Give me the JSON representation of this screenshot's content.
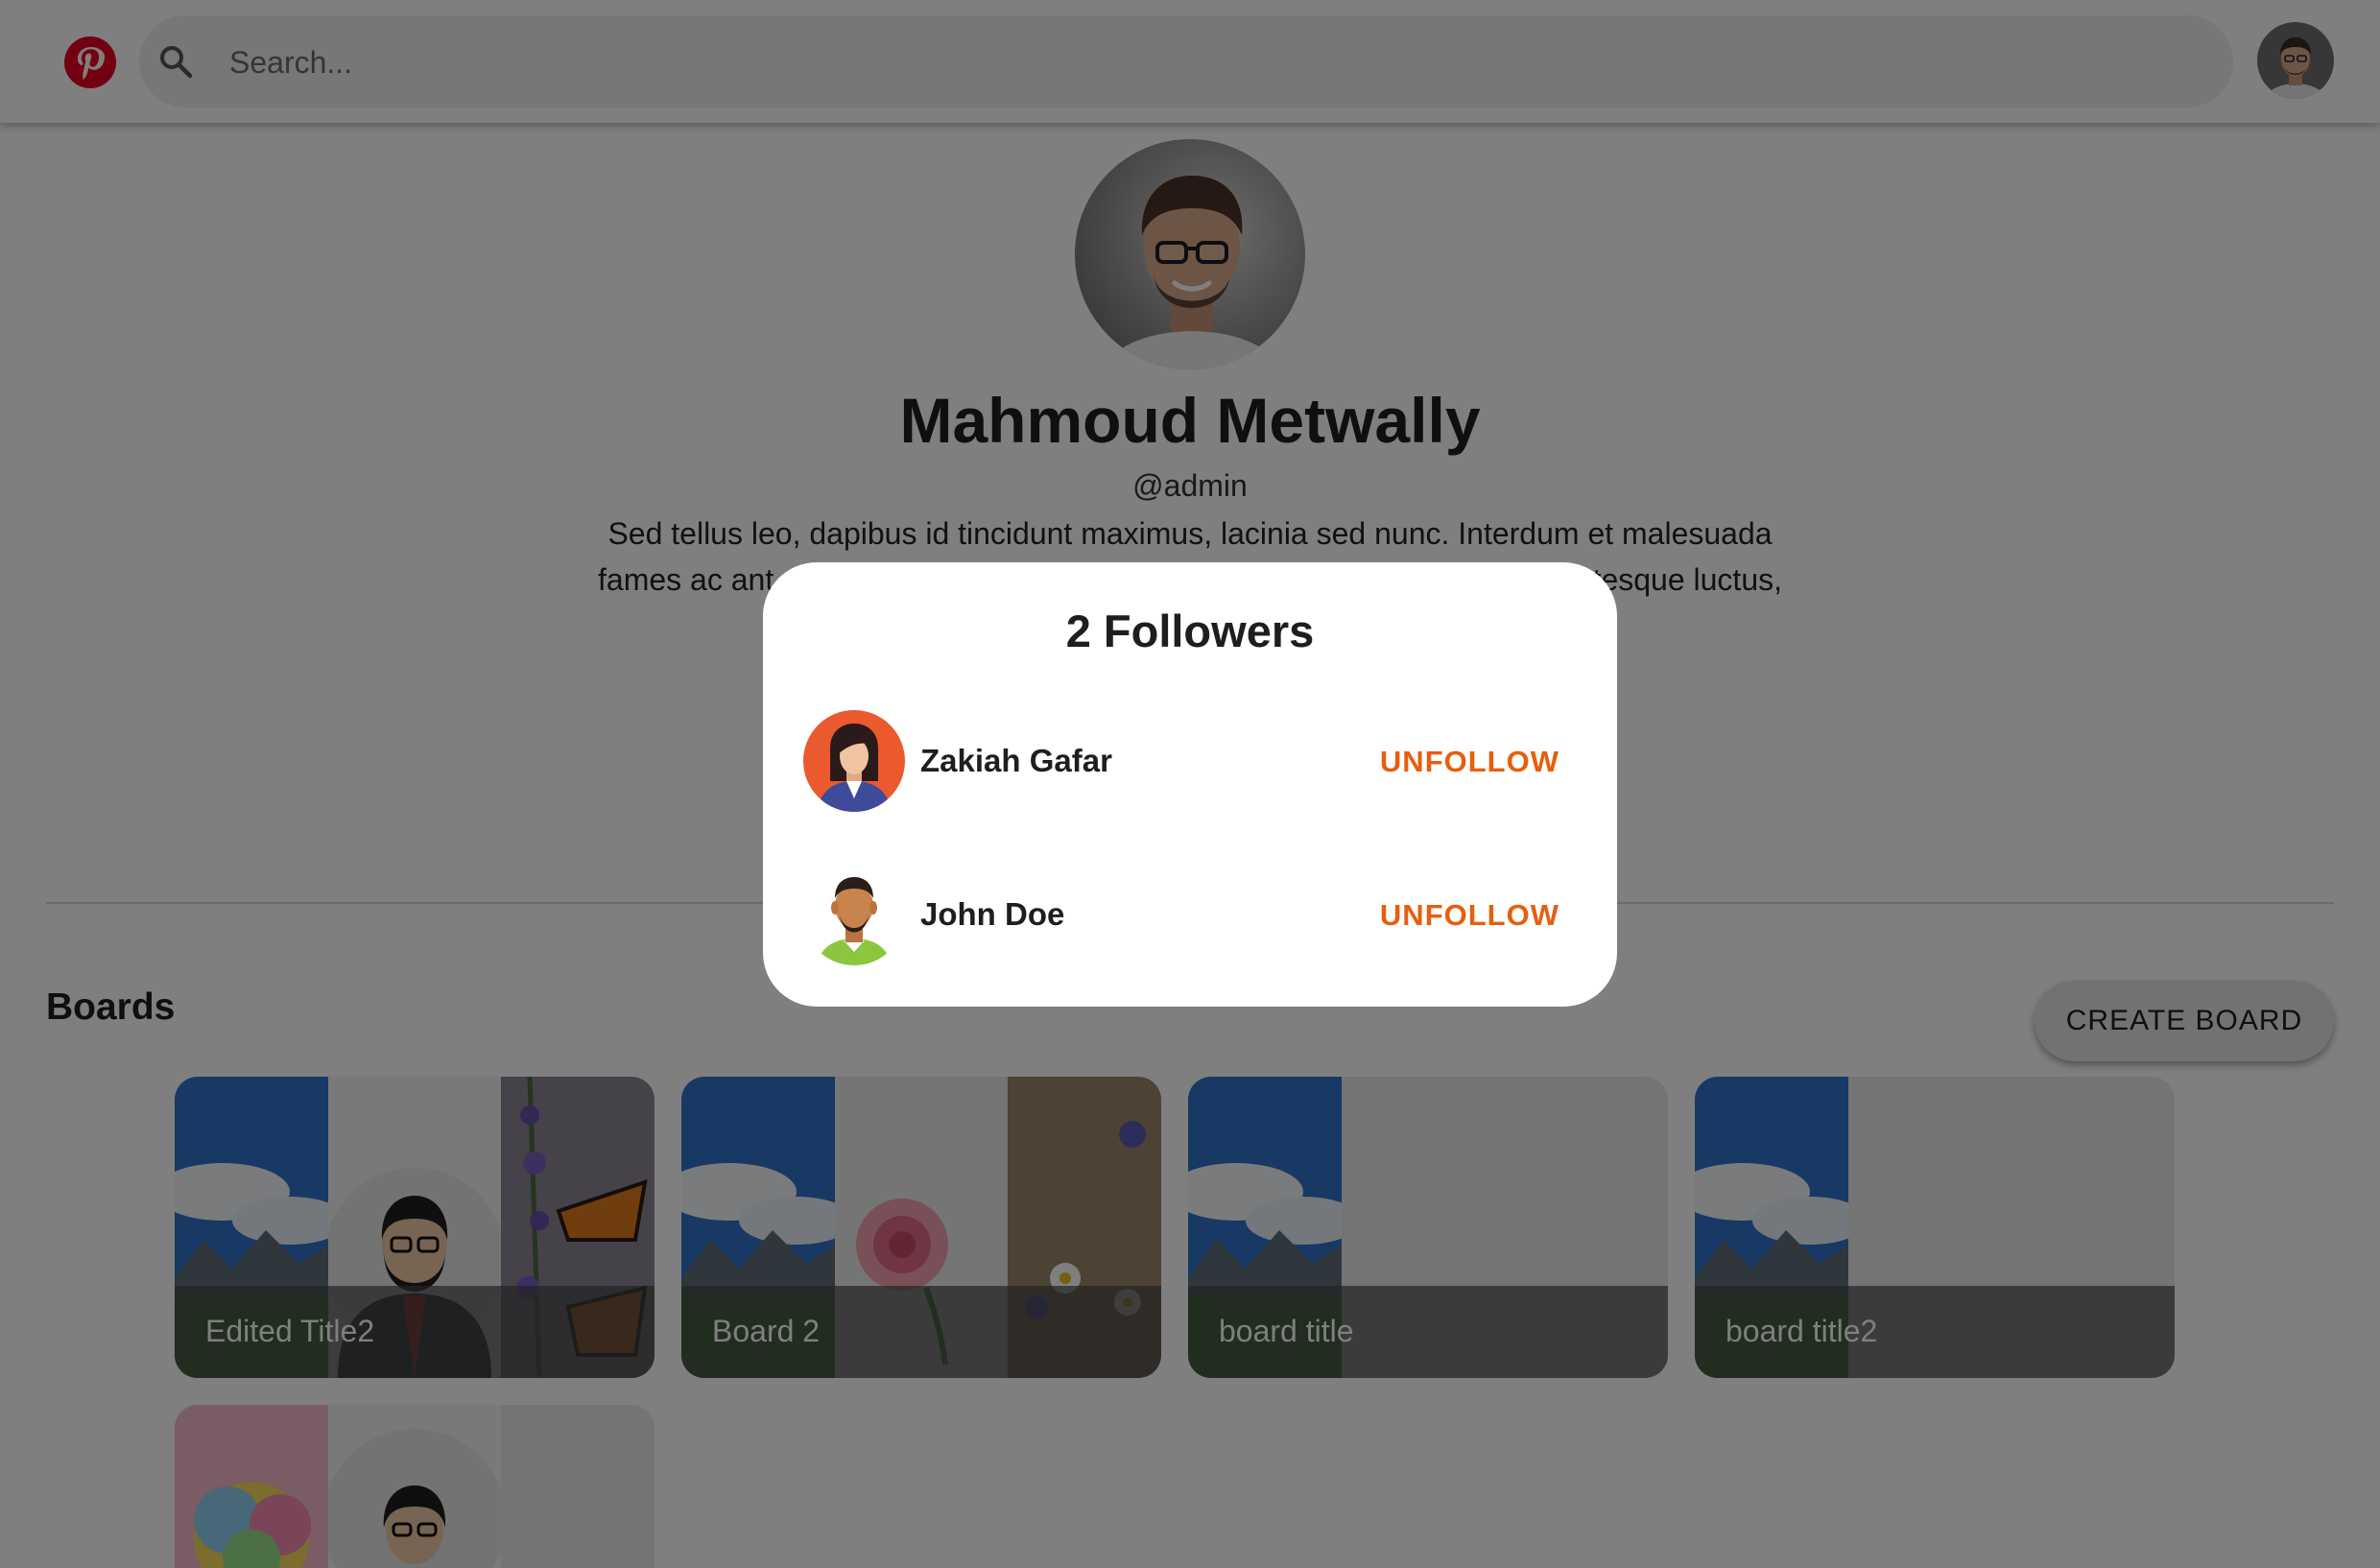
{
  "header": {
    "logo": "pinterest-logo",
    "search_icon": "search-icon",
    "search_placeholder": "Search...",
    "search_value": ""
  },
  "profile": {
    "name": "Mahmoud Metwally",
    "username": "@admin",
    "bio_line1": "Sed tellus leo, dapibus id tincidunt maximus, lacinia sed nunc. Interdum et malesuada",
    "bio_line2_left": "fames ac ant",
    "bio_line2_right": "tesque luctus,"
  },
  "boards": {
    "title": "Boards",
    "create_label": "CREATE BOARD",
    "items": [
      {
        "label": "Edited Title2"
      },
      {
        "label": "Board 2"
      },
      {
        "label": "board title"
      },
      {
        "label": "board title2"
      },
      {
        "label": ""
      }
    ]
  },
  "dialog": {
    "title": "2 Followers",
    "followers": [
      {
        "name": "Zakiah Gafar",
        "action": "UNFOLLOW"
      },
      {
        "name": "John Doe",
        "action": "UNFOLLOW"
      }
    ]
  },
  "colors": {
    "accent": "#e65f0e",
    "brand": "#e60023",
    "overlay": "rgba(0,0,0,0.5)"
  }
}
